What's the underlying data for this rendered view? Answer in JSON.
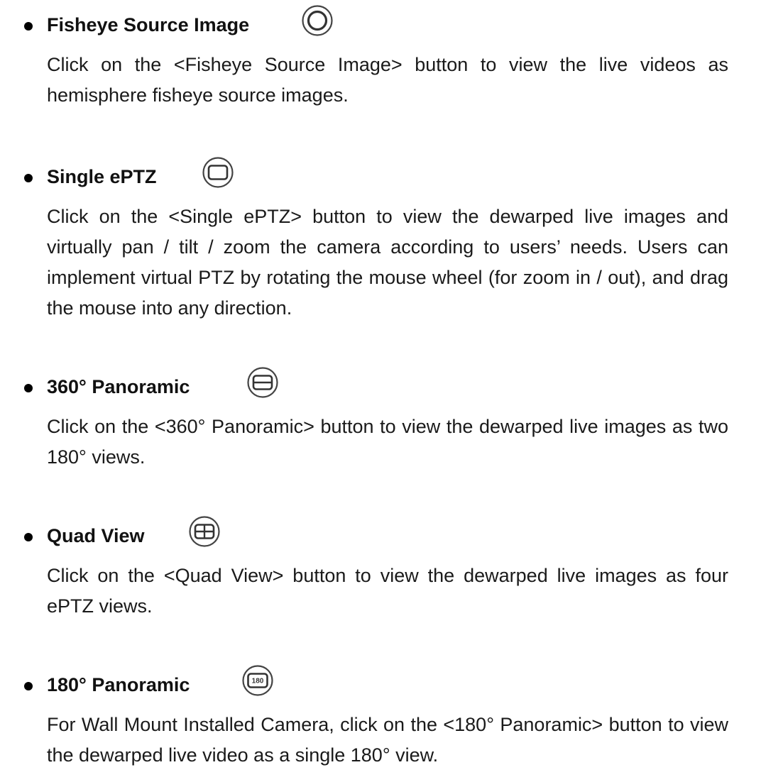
{
  "sections": [
    {
      "title": "Fisheye Source Image",
      "icon": "fisheye-source-icon",
      "description": "Click on the <Fisheye Source Image> button to view the live videos as hemisphere fisheye source images."
    },
    {
      "title": "Single ePTZ",
      "icon": "single-eptz-icon",
      "description": "Click on the <Single ePTZ> button to view the dewarped live images and virtually pan / tilt / zoom the camera according to users’ needs. Users can implement virtual PTZ by rotating the mouse wheel (for zoom in / out), and drag the mouse into any direction."
    },
    {
      "title": "360° Panoramic",
      "icon": "panoramic-360-icon",
      "description": "Click on the <360° Panoramic> button to view the dewarped live images as two 180° views."
    },
    {
      "title": "Quad View",
      "icon": "quad-view-icon",
      "description": "Click on the <Quad View> button to view the dewarped live images as four ePTZ views."
    },
    {
      "title": "180° Panoramic",
      "icon": "panoramic-180-icon",
      "icon_label": "180",
      "description": "For Wall Mount Installed Camera, click on the <180° Panoramic> button to view the dewarped live video as a single 180° view."
    }
  ]
}
